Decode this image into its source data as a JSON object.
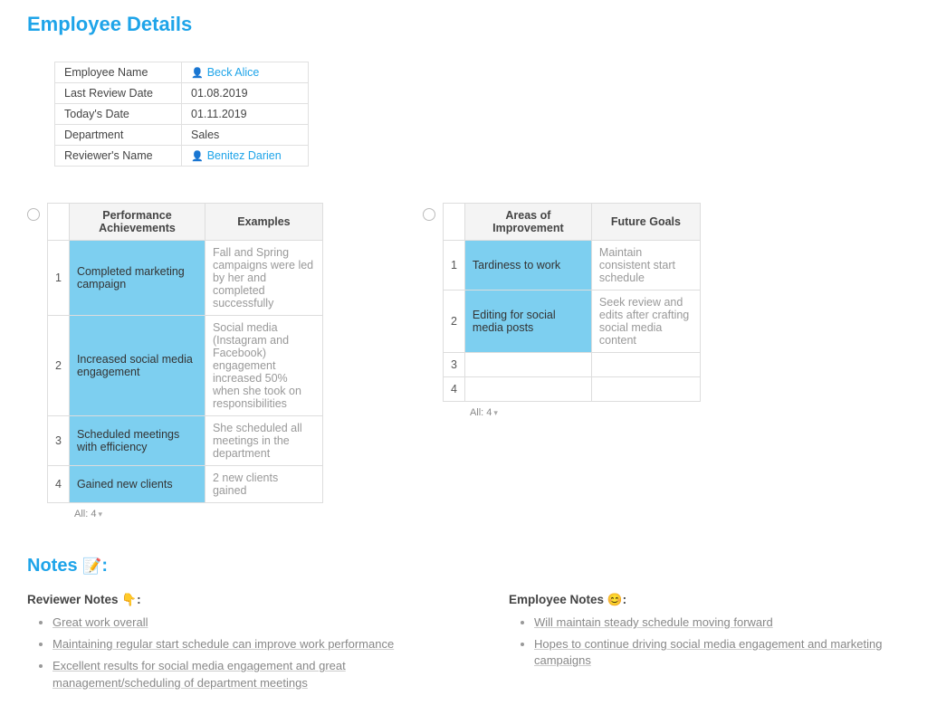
{
  "page_title": "Employee Details",
  "details": {
    "rows": [
      {
        "key": "Employee Name",
        "val": "Beck Alice",
        "link": true,
        "person": true
      },
      {
        "key": "Last Review Date",
        "val": "01.08.2019"
      },
      {
        "key": "Today's Date",
        "val": "01.11.2019"
      },
      {
        "key": "Department",
        "val": " Sales"
      },
      {
        "key": "Reviewer's Name",
        "val": "Benitez Darien",
        "link": true,
        "person": true
      }
    ]
  },
  "achievements": {
    "header": [
      "Performance Achievements",
      "Examples"
    ],
    "rows": [
      {
        "a": "Completed marketing campaign",
        "b": "Fall and Spring campaigns were led by her and completed successfully"
      },
      {
        "a": "Increased social media engagement",
        "b": "Social media (Instagram and Facebook) engagement increased 50% when she took on responsibilities"
      },
      {
        "a": "Scheduled meetings with efficiency",
        "b": "She scheduled all meetings in the department"
      },
      {
        "a": "Gained new clients",
        "b": "2 new clients gained"
      }
    ],
    "footer": "All: 4"
  },
  "improvements": {
    "header": [
      "Areas of Improvement",
      "Future Goals"
    ],
    "rows": [
      {
        "a": "Tardiness to work",
        "b": "Maintain consistent start schedule"
      },
      {
        "a": "Editing for social media posts",
        "b": "Seek review and edits after crafting social media content"
      },
      {
        "a": "",
        "b": ""
      },
      {
        "a": "",
        "b": ""
      }
    ],
    "footer": "All: 4"
  },
  "notes_title": "Notes",
  "notes_emoji": "📝",
  "reviewer_notes": {
    "title": "Reviewer Notes",
    "emoji": "👇",
    "items": [
      "Great work overall",
      "Maintaining regular start schedule can improve work performance",
      "Excellent results for social media engagement and great management/scheduling of department meetings"
    ]
  },
  "employee_notes": {
    "title": "Employee Notes",
    "emoji": "😊",
    "items": [
      "Will maintain steady schedule moving forward",
      "Hopes to continue driving social media engagement and marketing campaigns"
    ]
  }
}
